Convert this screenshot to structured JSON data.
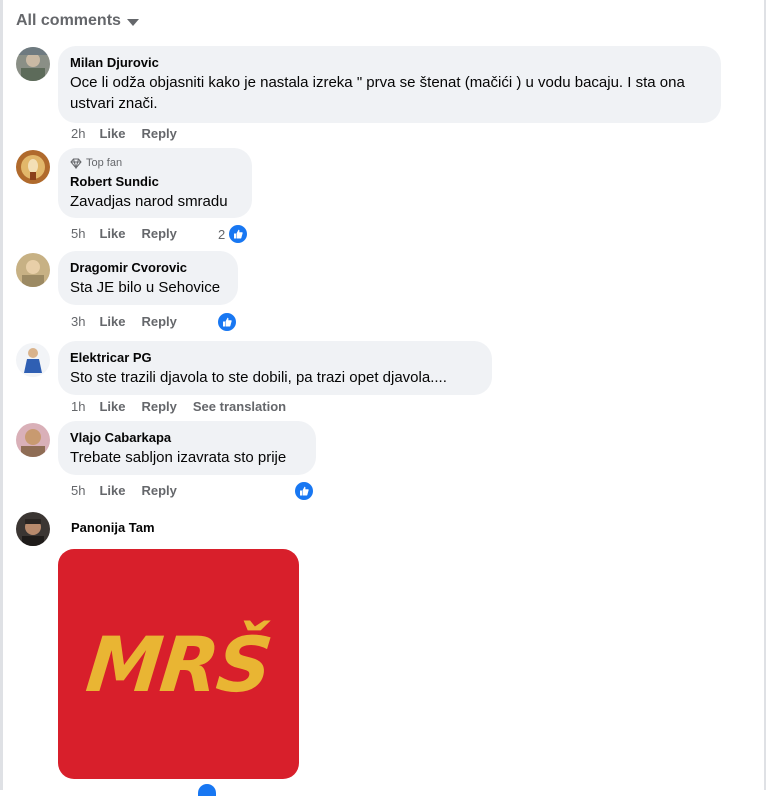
{
  "header": {
    "sort_label": "All comments"
  },
  "comments": [
    {
      "author": "Milan Djurovic",
      "text": "Oce li odža objasniti kako je nastala izreka \" prva se štenat (mačići ) u vodu bacaju. I sta ona ustvari znači.",
      "time": "2h",
      "like": "Like",
      "reply": "Reply"
    },
    {
      "author": "Robert Sundic",
      "badge": "Top fan",
      "text": "Zavadjas narod smradu",
      "time": "5h",
      "like": "Like",
      "reply": "Reply",
      "reaction_count": "2"
    },
    {
      "author": "Dragomir Cvorovic",
      "text": "Sta JE bilo u Sehovice",
      "time": "3h",
      "like": "Like",
      "reply": "Reply"
    },
    {
      "author": "Elektricar PG",
      "text": "Sto ste trazili djavola to ste dobili, pa trazi opet djavola....",
      "time": "1h",
      "like": "Like",
      "reply": "Reply",
      "translate": "See translation"
    },
    {
      "author": "Vlajo Cabarkapa",
      "text": "Trebate sabljon izavrata sto prije",
      "time": "5h",
      "like": "Like",
      "reply": "Reply"
    },
    {
      "author": "Panonija Tam",
      "image_text": "MRŠ"
    }
  ],
  "colors": {
    "accent": "#1877f2",
    "bubble": "#f0f2f5",
    "muted": "#65676b",
    "image_bg": "#d81f2b",
    "image_fg": "#e9b533"
  },
  "icons": [
    "chevron-down-icon",
    "diamond-icon",
    "like-reaction-icon"
  ]
}
